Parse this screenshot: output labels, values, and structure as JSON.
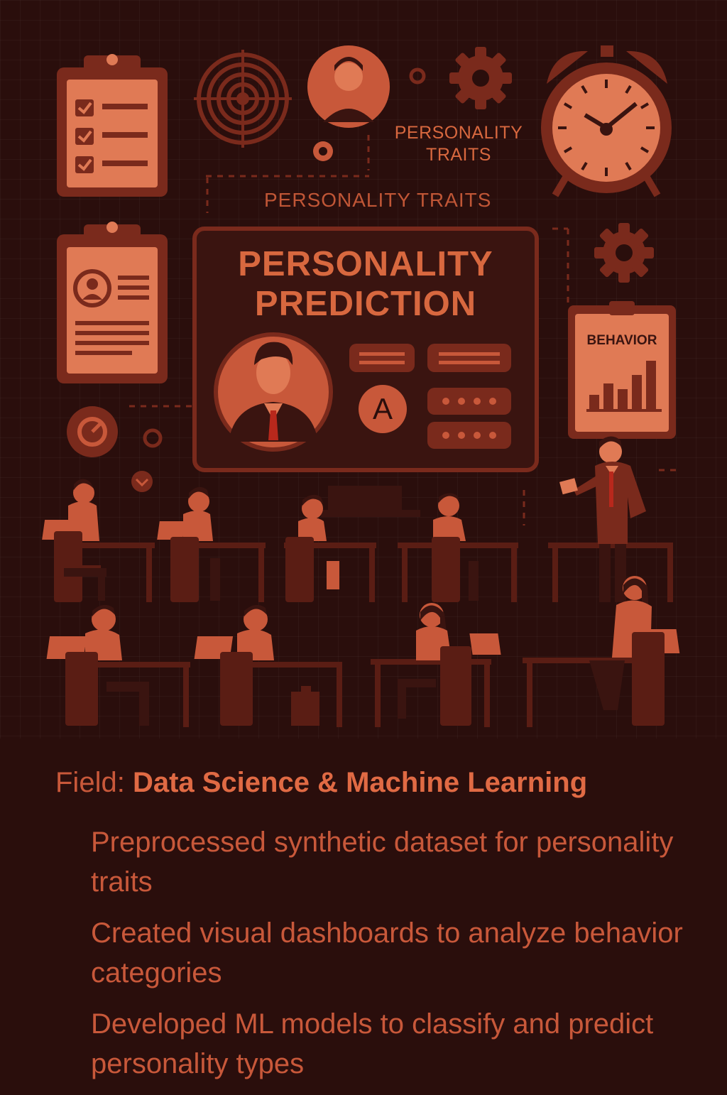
{
  "header_labels": {
    "traits_small": "PERSONALITY TRAITS",
    "traits_wide": "PERSONALITY TRAITS"
  },
  "main_board": {
    "title": "PERSONALITY PREDICTION",
    "badge_letter": "A"
  },
  "behavior_card": {
    "label": "BEHAVIOR",
    "bars": [
      0.25,
      0.45,
      0.35,
      0.6,
      0.85
    ]
  },
  "field": {
    "prefix": "Field:",
    "value": "Data Science & Machine Learning"
  },
  "bullets": [
    "Preprocessed synthetic dataset for personality traits",
    "Created visual dashboards to analyze behavior categories",
    "Developed ML models to classify and predict personality types"
  ],
  "colors": {
    "background": "#2a0e0c",
    "accent": "#d8683f",
    "panel": "#e07a55",
    "dark_red": "#7a2a1c"
  },
  "icons": [
    "checklist-clipboard-icon",
    "target-icon",
    "avatar-icon",
    "gear-icon",
    "alarm-clock-icon",
    "profile-clipboard-icon",
    "bar-chart-icon",
    "dial-icon"
  ]
}
